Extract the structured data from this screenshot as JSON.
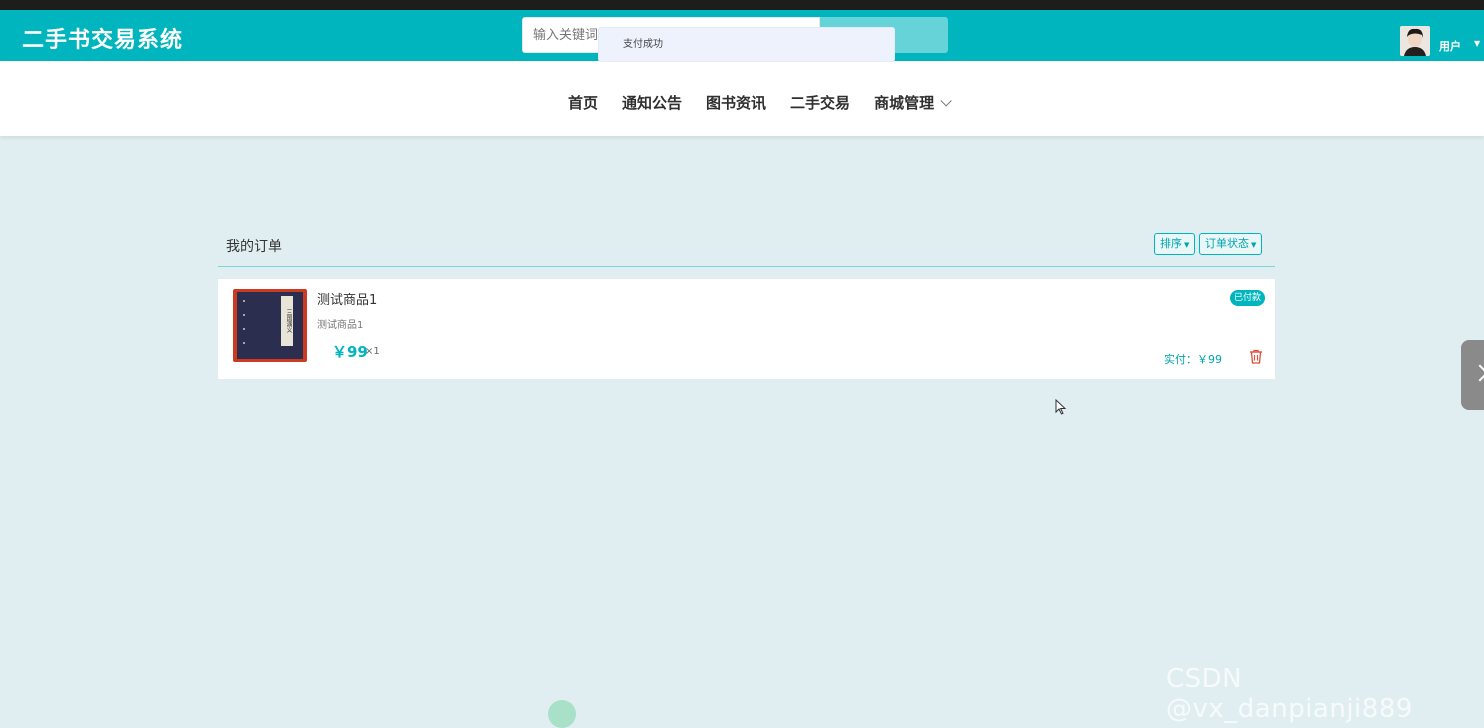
{
  "header": {
    "logo_text": "二手书交易系统",
    "search_placeholder": "输入关键词",
    "toast_message": "支付成功",
    "username": "用户",
    "accent_color": "#00b5bd"
  },
  "nav": {
    "items": [
      {
        "label": "首页"
      },
      {
        "label": "通知公告"
      },
      {
        "label": "图书资讯"
      },
      {
        "label": "二手交易"
      },
      {
        "label": "商城管理",
        "has_dropdown": true
      }
    ]
  },
  "orders": {
    "title": "我的订单",
    "sort_label": "排序",
    "status_filter_label": "订单状态",
    "items": [
      {
        "name": "测试商品1",
        "subtitle": "测试商品1",
        "price": "￥99",
        "quantity": "×1",
        "status": "已付款",
        "paid_label": "实付：￥99",
        "cover_text": "三国演义"
      }
    ]
  },
  "watermark": "CSDN @vx_danpianji889"
}
